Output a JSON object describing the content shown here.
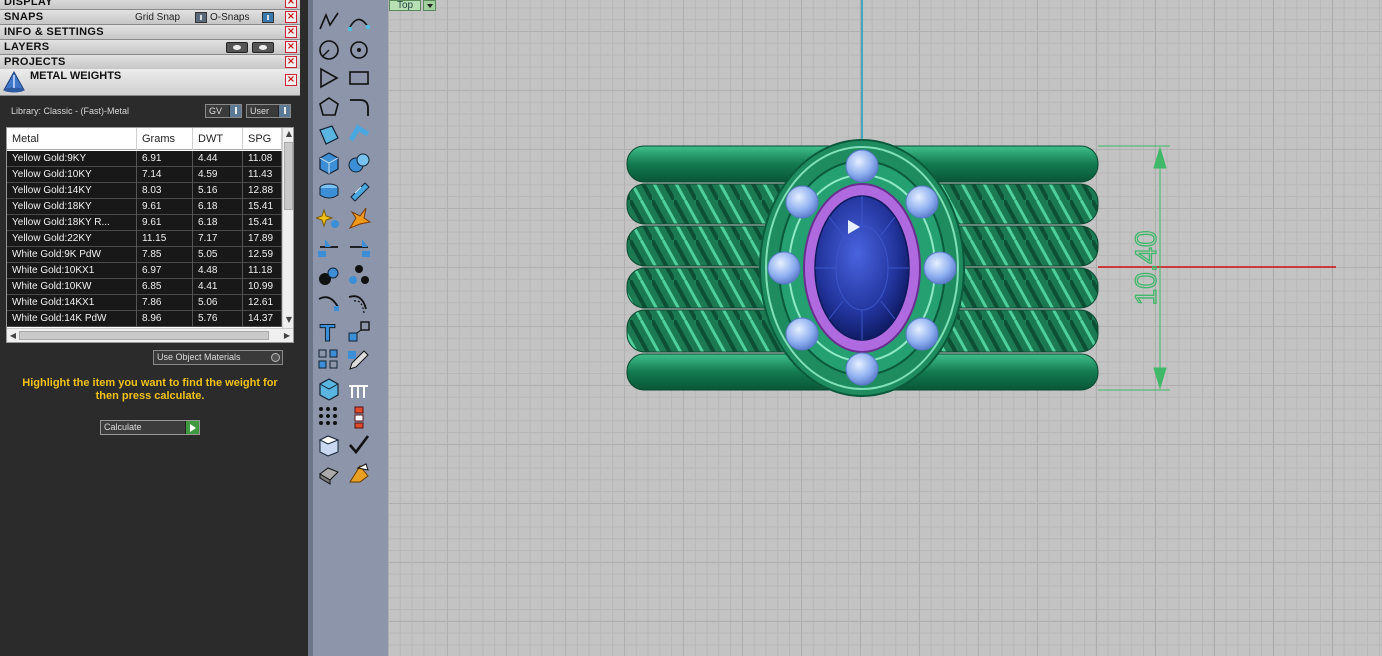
{
  "panels": {
    "display": "DISPLAY",
    "snaps": "SNAPS",
    "grid_snap": "Grid Snap",
    "o_snaps": "O-Snaps",
    "info_settings": "INFO & SETTINGS",
    "layers": "LAYERS",
    "projects": "PROJECTS",
    "metal_weights": "METAL WEIGHTS",
    "close_glyph": "×"
  },
  "metal_weights": {
    "library": "Library: Classic - (Fast)-Metal",
    "gv": "GV",
    "user": "User",
    "columns": [
      "Metal",
      "Grams",
      "DWT",
      "SPG"
    ],
    "rows": [
      [
        "Yellow Gold:9KY",
        "6.91",
        "4.44",
        "11.08"
      ],
      [
        "Yellow Gold:10KY",
        "7.14",
        "4.59",
        "11.43"
      ],
      [
        "Yellow Gold:14KY",
        "8.03",
        "5.16",
        "12.88"
      ],
      [
        "Yellow Gold:18KY",
        "9.61",
        "6.18",
        "15.41"
      ],
      [
        "Yellow Gold:18KY R...",
        "9.61",
        "6.18",
        "15.41"
      ],
      [
        "Yellow Gold:22KY",
        "11.15",
        "7.17",
        "17.89"
      ],
      [
        "White Gold:9K PdW",
        "7.85",
        "5.05",
        "12.59"
      ],
      [
        "White Gold:10KX1",
        "6.97",
        "4.48",
        "11.18"
      ],
      [
        "White Gold:10KW",
        "6.85",
        "4.41",
        "10.99"
      ],
      [
        "White Gold:14KX1",
        "7.86",
        "5.06",
        "12.61"
      ],
      [
        "White Gold:14K PdW",
        "8.96",
        "5.76",
        "14.37"
      ]
    ],
    "scroll_up": "▲",
    "scroll_down": "▼",
    "scroll_left": "◀",
    "scroll_right": "▶",
    "use_object_materials": "Use Object Materials",
    "hint": "Highlight the item you want to find the weight for then press calculate.",
    "calculate": "Calculate"
  },
  "toolbar": {
    "icons": [
      "polyline-icon",
      "curve-edit-icon",
      "arc-icon",
      "circle-point-icon",
      "triangle-icon",
      "rectangle-icon",
      "polygon-icon",
      "fillet-icon",
      "surface-patch-icon",
      "bend-icon",
      "cube-icon",
      "boolean-icon",
      "pipe-icon",
      "gem-set-icon",
      "sparkle-icon",
      "explode-icon",
      "split-icon",
      "trim-icon",
      "spheres-icon",
      "array-icon",
      "curve-offset-icon",
      "rail-icon",
      "text-tool-icon",
      "scale-icon",
      "grid-array-icon",
      "pencil-icon",
      "box-icon",
      "prongs-icon",
      "dot-grid-icon",
      "dimension-icon",
      "solid-icon",
      "check-icon",
      "extrude-icon",
      "paint-icon"
    ]
  },
  "viewport": {
    "view_name": "Top",
    "dimension_text": "10.40",
    "colors": {
      "grid": "#c3c3c3",
      "ring": "#1a8a5c",
      "gem": "#2b3fa8",
      "bezel": "#a35ad0",
      "dimension": "#3fb86a",
      "x_axis": "#d01010",
      "y_axis": "#1aa0b8"
    }
  }
}
